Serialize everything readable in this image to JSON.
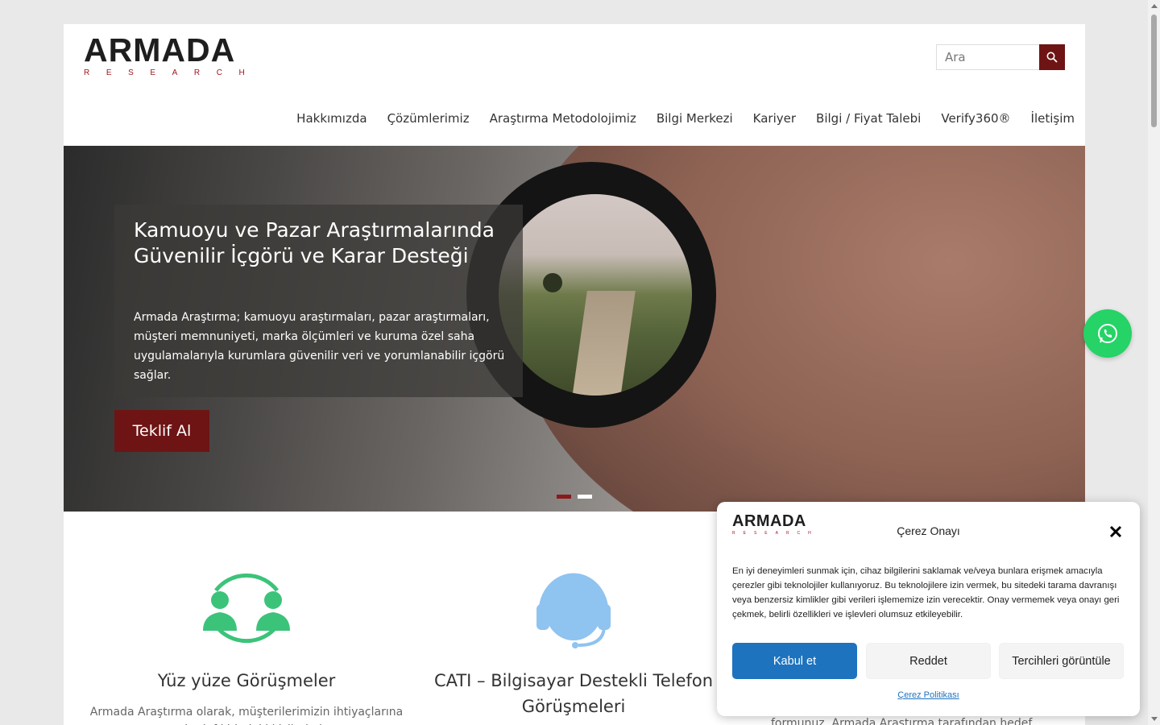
{
  "logo": {
    "main": "ARMADA",
    "sub": "RESEARCH"
  },
  "search": {
    "placeholder": "Ara",
    "icon": "search-icon"
  },
  "nav": {
    "items": [
      "Hakkımızda",
      "Çözümlerimiz",
      "Araştırma Metodolojimiz",
      "Bilgi Merkezi",
      "Kariyer",
      "Bilgi / Fiyat Talebi",
      "Verify360®",
      "İletişim"
    ]
  },
  "hero": {
    "title": "Kamuoyu ve Pazar Araştırmalarında Güvenilir İçgörü ve Karar Desteği",
    "text": "Armada Araştırma; kamuoyu araştırmaları, pazar araştırmaları, müşteri memnuniyeti, marka ölçümleri ve kuruma özel saha uygulamalarıyla kurumlara güvenilir veri ve yorumlanabilir içgörü sağlar.",
    "button": "Teklif Al",
    "slides": 2,
    "active_slide": 1
  },
  "features": [
    {
      "icon": "face-to-face-icon",
      "title": "Yüz yüze Görüşmeler",
      "text": "Armada Araştırma olarak, müşterilerimizin ihtiyaçlarına uygun hedef kitledeki kişilerle bane"
    },
    {
      "icon": "headset-icon",
      "title": "CATI – Bilgisayar Destekli Telefon Görüşmeleri",
      "text": ""
    }
  ],
  "partial_text": "formunuz, Armada Araştırma tarafından hedef",
  "cookie": {
    "logo_main": "ARMADA",
    "logo_sub": "RESEARCH",
    "title": "Çerez Onayı",
    "text": "En iyi deneyimleri sunmak için, cihaz bilgilerini saklamak ve/veya bunlara erişmek amacıyla çerezler gibi teknolojiler kullanıyoruz. Bu teknolojilere izin vermek, bu sitedeki tarama davranışı veya benzersiz kimlikler gibi verileri işlememize izin verecektir. Onay vermemek veya onayı geri çekmek, belirli özellikleri ve işlevleri olumsuz etkileyebilir.",
    "accept": "Kabul et",
    "deny": "Reddet",
    "preferences": "Tercihleri görüntüle",
    "policy": "Çerez Politikası"
  },
  "colors": {
    "brand_red": "#6e1414",
    "accent_blue": "#1e73be",
    "whatsapp": "#25d366",
    "icon_green": "#3cc37a",
    "icon_blue": "#8fc3f0"
  }
}
